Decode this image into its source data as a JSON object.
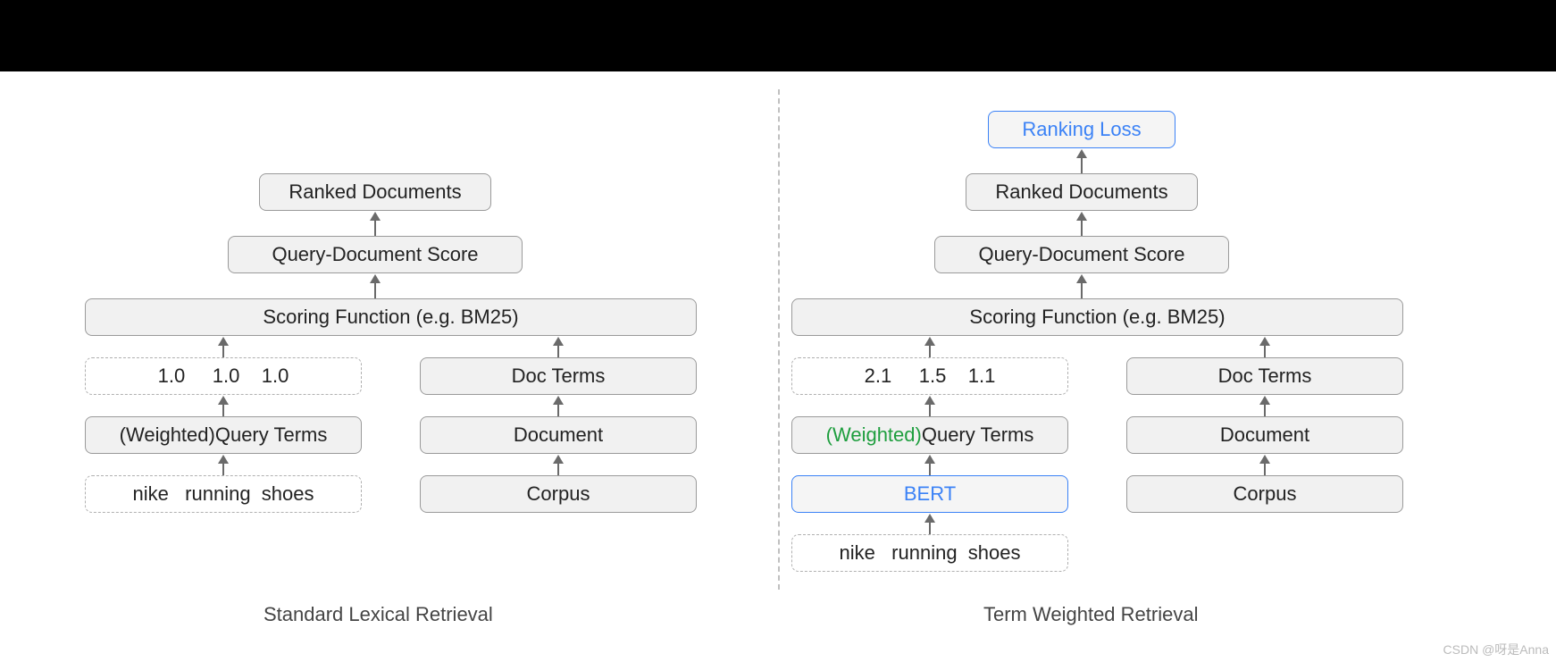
{
  "left": {
    "caption": "Standard Lexical Retrieval",
    "ranked": "Ranked Documents",
    "score": "Query-Document Score",
    "func": "Scoring Function (e.g. BM25)",
    "weights": "1.0     1.0    1.0",
    "docterms": "Doc Terms",
    "wqt_prefix": "(Weighted)",
    "wqt_rest": " Query Terms",
    "document": "Document",
    "query": "nike   running  shoes",
    "corpus": "Corpus"
  },
  "right": {
    "caption": "Term Weighted Retrieval",
    "loss": "Ranking Loss",
    "ranked": "Ranked Documents",
    "score": "Query-Document Score",
    "func": "Scoring Function (e.g. BM25)",
    "weights": "2.1     1.5    1.1",
    "docterms": "Doc Terms",
    "wqt_prefix": "(Weighted)",
    "wqt_rest": " Query Terms",
    "document": "Document",
    "bert": "BERT",
    "corpus": "Corpus",
    "query": "nike   running  shoes"
  },
  "watermark": "CSDN @呀是Anna"
}
